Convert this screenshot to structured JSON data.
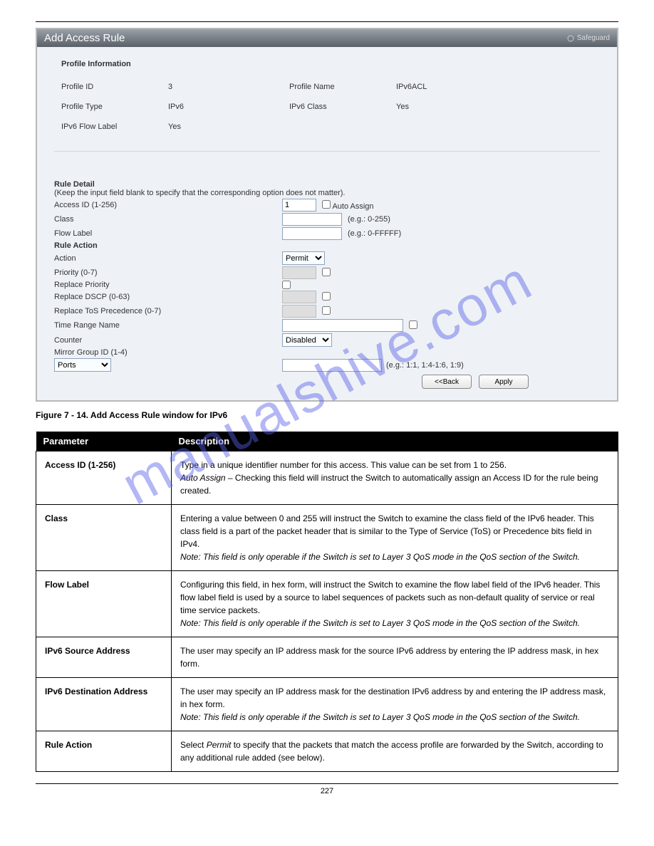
{
  "page_number": "227",
  "watermark_text": "manualshive.com",
  "panel": {
    "title": "Add Access Rule",
    "safeguard": "Safeguard",
    "profile_info_title": "Profile Information",
    "profile": {
      "id_label": "Profile ID",
      "id_value": "3",
      "name_label": "Profile Name",
      "name_value": "IPv6ACL",
      "type_label": "Profile Type",
      "type_value": "IPv6",
      "class_label": "IPv6 Class",
      "class_value": "Yes",
      "flow_label_label": "IPv6 Flow Label",
      "flow_label_value": "Yes"
    },
    "rule": {
      "title": "Rule Detail",
      "hint": "(Keep the input field blank to specify that the corresponding option does not matter).",
      "access_id_label": "Access ID (1-256)",
      "access_id_value": "1",
      "auto_assign": "Auto Assign",
      "class_label": "Class",
      "class_hint": "(e.g.: 0-255)",
      "flow_label_label": "Flow Label",
      "flow_label_hint": "(e.g.: 0-FFFFF)",
      "rule_action_title": "Rule Action",
      "action_label": "Action",
      "action_value": "Permit",
      "priority_label": "Priority (0-7)",
      "replace_priority_label": "Replace Priority",
      "replace_dscp_label": "Replace DSCP (0-63)",
      "replace_tos_label": "Replace ToS Precedence (0-7)",
      "time_range_label": "Time Range Name",
      "counter_label": "Counter",
      "counter_value": "Disabled",
      "mirror_group_label": "Mirror Group ID (1-4)",
      "ports_value": "Ports",
      "ports_hint": "(e.g.: 1:1, 1:4-1:6, 1:9)",
      "back_btn": "<<Back",
      "apply_btn": "Apply"
    }
  },
  "figure_caption": "Figure 7 - 14. Add Access Rule window for IPv6",
  "table": {
    "header_param": "Parameter",
    "header_desc": "Description",
    "rows": [
      {
        "param": "Access ID (1-256)",
        "desc_lines": [
          "Type in a unique identifier number for this access. This value can be set from 1 to 256.",
          "<em>Auto Assign</em> – Checking this field will instruct the Switch to automatically assign an Access ID for the rule being created."
        ]
      },
      {
        "param": "Class",
        "desc_lines": [
          "Entering a value between 0 and 255 will instruct the Switch to examine the class field of the IPv6 header. This class field is a part of the packet header that is similar to the Type of Service (ToS) or Precedence bits field in IPv4.",
          "<em>Note: This field is only operable if the Switch is set to Layer 3 QoS mode in the QoS section of the Switch.</em>"
        ]
      },
      {
        "param": "Flow Label",
        "desc_lines": [
          "Configuring this field, in hex form, will instruct the Switch to examine the flow label field of the IPv6 header. This flow label field is used by a source to label sequences of packets such as non-default quality of service or real time service packets.",
          "<em>Note: This field is only operable if the Switch is set to Layer 3 QoS mode in the QoS section of the Switch.</em>"
        ]
      },
      {
        "param": "IPv6 Source Address",
        "desc_lines": [
          "The user may specify an IP address mask for the source IPv6 address by entering the IP address mask, in hex form."
        ]
      },
      {
        "param": "IPv6 Destination Address",
        "desc_lines": [
          "The user may specify an IP address mask for the destination IPv6 address by and entering the IP address mask, in hex form.",
          "<em>Note: This field is only operable if the Switch is set to Layer 3 QoS mode in the QoS section of the Switch.</em>"
        ]
      },
      {
        "param": "Rule Action",
        "desc_lines": [
          "Select <em>Permit</em> to specify that the packets that match the access profile are forwarded by the Switch, according to any additional rule added (see below)."
        ]
      }
    ]
  }
}
